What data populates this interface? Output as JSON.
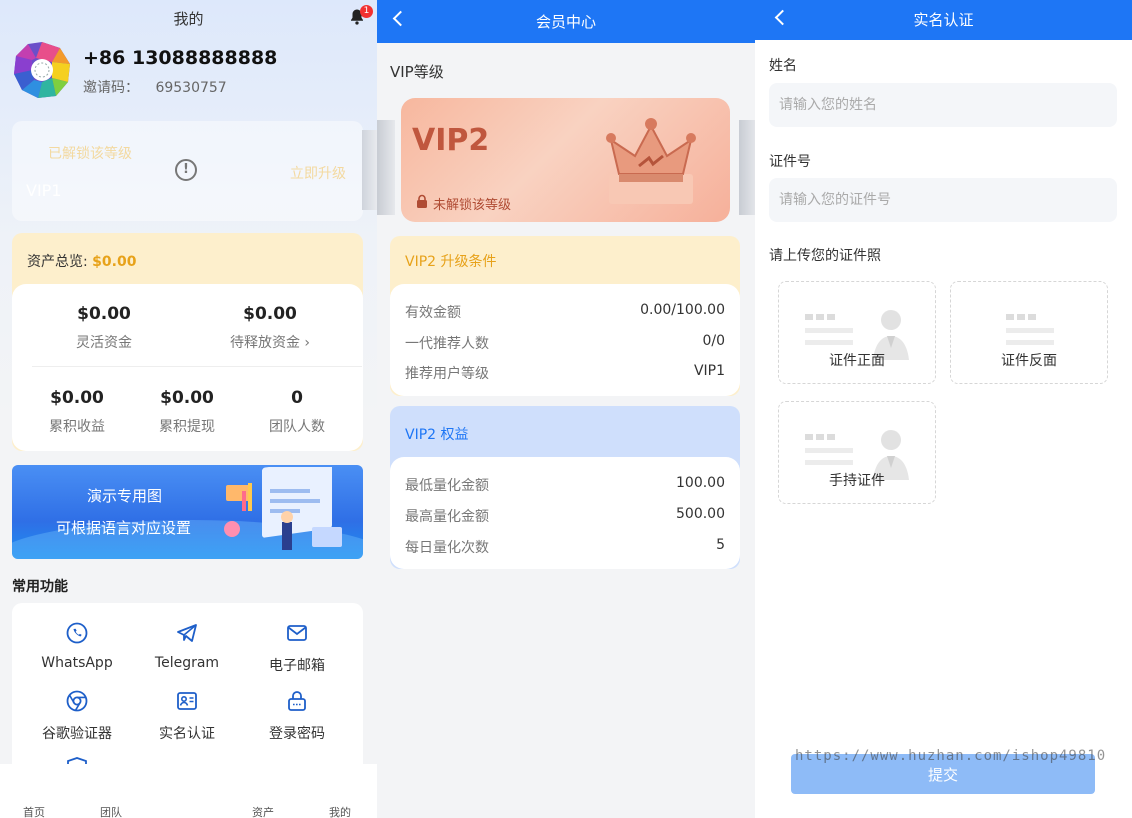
{
  "mine": {
    "title": "我的",
    "notification_count": "1",
    "phone": "+86 13088888888",
    "invite_label": "邀请码：",
    "invite_code": "69530757",
    "vip": {
      "unlocked_label": "已解锁该等级",
      "level": "VIP1",
      "upgrade_label": "立即升级",
      "warn_glyph": "!"
    },
    "assets": {
      "label": "资产总览:",
      "total": "$0.00",
      "stats": [
        {
          "value": "$0.00",
          "label": "灵活资金"
        },
        {
          "value": "$0.00",
          "label": "待释放资金 ›"
        },
        {
          "value": "$0.00",
          "label": "累积收益"
        },
        {
          "value": "$0.00",
          "label": "累积提现"
        },
        {
          "value": "0",
          "label": "团队人数"
        }
      ]
    },
    "banner": {
      "line1": "演示专用图",
      "line2": "可根据语言对应设置"
    },
    "functions_title": "常用功能",
    "functions": [
      {
        "label": "WhatsApp",
        "icon": "whatsapp-icon"
      },
      {
        "label": "Telegram",
        "icon": "telegram-icon"
      },
      {
        "label": "电子邮箱",
        "icon": "mail-icon"
      },
      {
        "label": "谷歌验证器",
        "icon": "chrome-icon"
      },
      {
        "label": "实名认证",
        "icon": "id-card-icon"
      },
      {
        "label": "登录密码",
        "icon": "lock-icon"
      }
    ],
    "tabs": [
      "首页",
      "团队",
      "资产",
      "我的"
    ]
  },
  "member": {
    "title": "会员中心",
    "section": "VIP等级",
    "card": {
      "name": "VIP2",
      "lock_text": "未解锁该等级"
    },
    "conditions": {
      "title": "VIP2 升级条件",
      "rows": [
        {
          "k": "有效金额",
          "v": "0.00/100.00"
        },
        {
          "k": "一代推荐人数",
          "v": "0/0"
        },
        {
          "k": "推荐用户等级",
          "v": "VIP1"
        }
      ]
    },
    "benefits": {
      "title": "VIP2 权益",
      "rows": [
        {
          "k": "最低量化金额",
          "v": "100.00"
        },
        {
          "k": "最高量化金额",
          "v": "500.00"
        },
        {
          "k": "每日量化次数",
          "v": "5"
        }
      ]
    }
  },
  "verify": {
    "title": "实名认证",
    "name_label": "姓名",
    "name_placeholder": "请输入您的姓名",
    "id_label": "证件号",
    "id_placeholder": "请输入您的证件号",
    "upload_label": "请上传您的证件照",
    "uploads": [
      "证件正面",
      "证件反面",
      "手持证件"
    ],
    "submit": "提交",
    "watermark": "https://www.huzhan.com/ishop49810"
  },
  "colors": {
    "brand_blue": "#1e76f5",
    "gold": "#e7a21a",
    "badge_red": "#f23030",
    "vip_text": "#c0573e"
  }
}
